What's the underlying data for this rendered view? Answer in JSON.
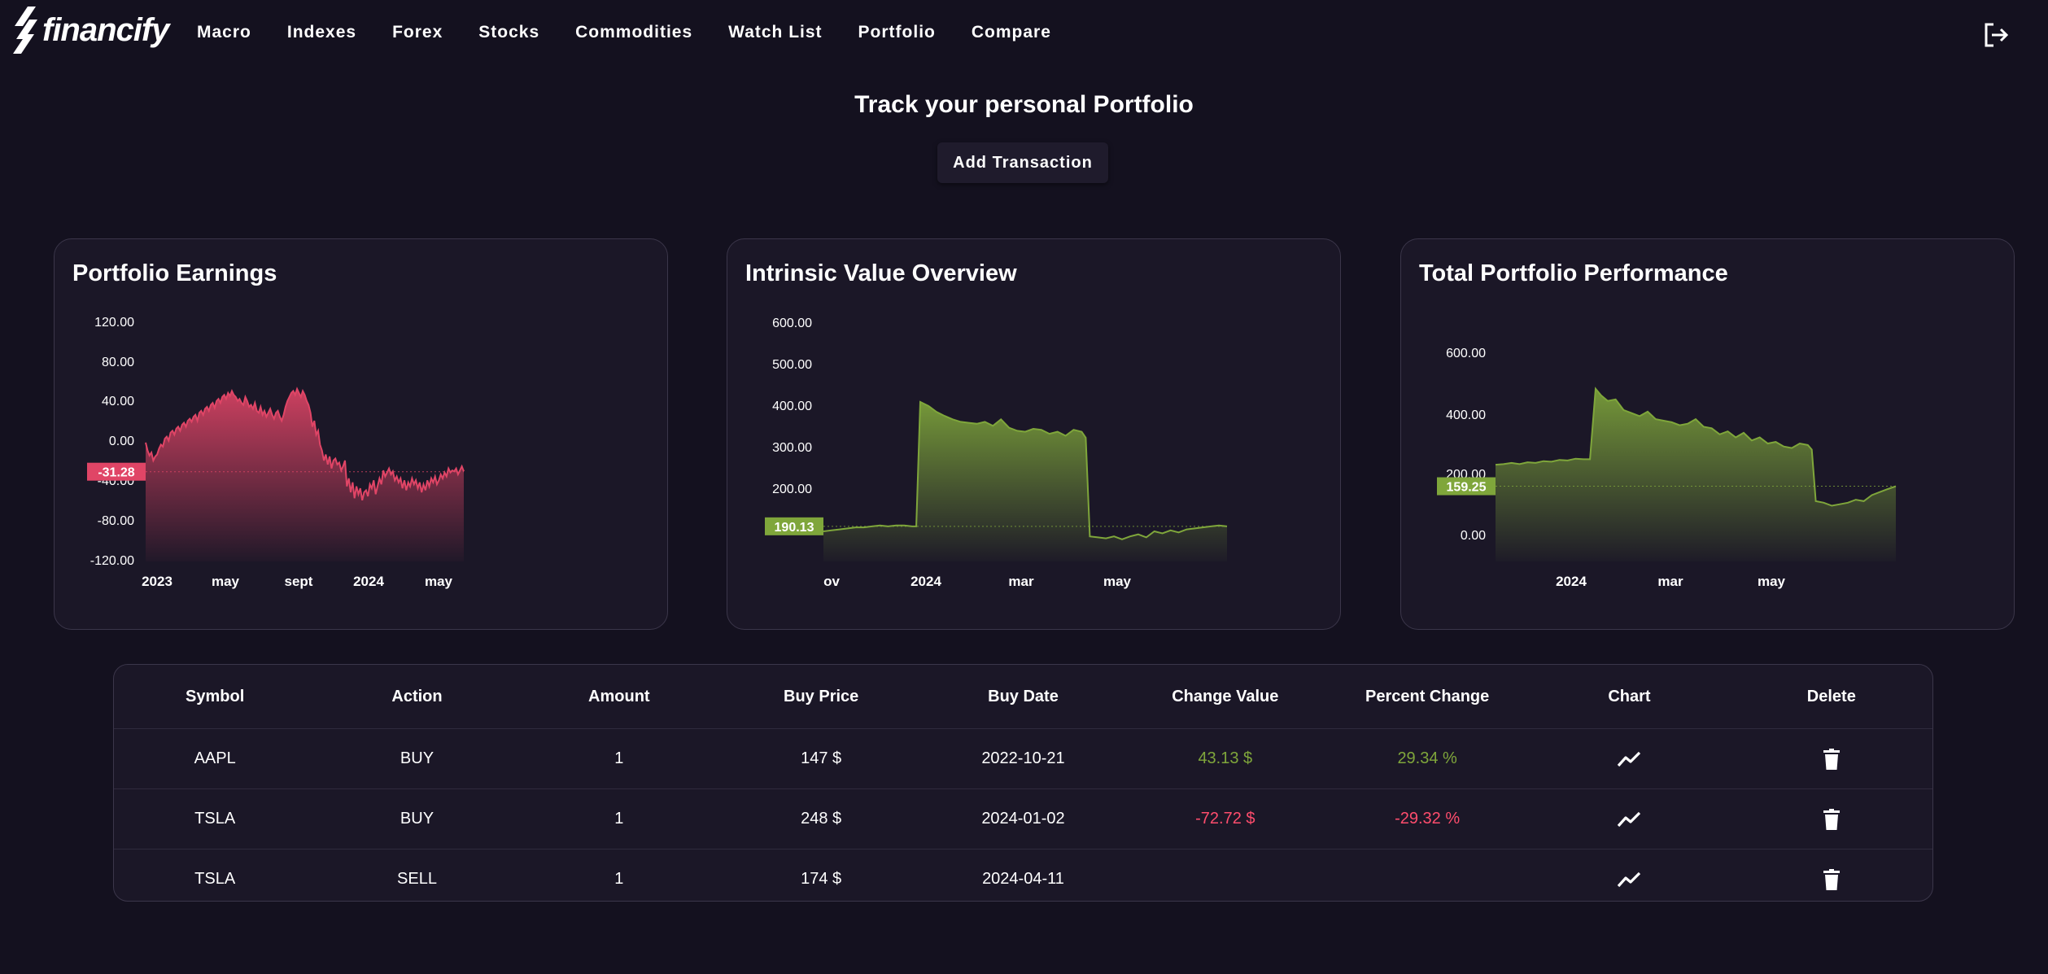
{
  "nav": {
    "logo_text": "financify",
    "links": [
      "Macro",
      "Indexes",
      "Forex",
      "Stocks",
      "Commodities",
      "Watch List",
      "Portfolio",
      "Compare"
    ],
    "logout_icon": "logout-icon"
  },
  "header": {
    "title": "Track your personal Portfolio",
    "add_button": "Add Transaction"
  },
  "colors": {
    "background": "#14111f",
    "negative": "#ff4d6d",
    "positive": "#7fa63b",
    "card": "#1b1727"
  },
  "chart_data": [
    {
      "type": "area",
      "title": "Portfolio Earnings",
      "y_ticks": [
        "120.00",
        "80.00",
        "40.00",
        "0.00",
        "-40.00",
        "-80.00",
        "-120.00"
      ],
      "x_ticks": [
        "2023",
        "may",
        "sept",
        "2024",
        "may"
      ],
      "ylim": [
        -120,
        120
      ],
      "current_value_label": "-31.28",
      "color": "#e04566",
      "x": [
        0,
        3,
        6,
        9,
        12,
        15,
        18,
        21,
        24,
        27,
        30,
        33,
        36,
        39,
        42,
        45,
        48,
        51,
        54,
        57,
        60,
        63,
        66,
        69,
        72,
        75,
        78,
        81,
        84,
        87,
        90,
        93,
        96,
        99,
        102,
        105,
        108,
        111,
        114,
        117,
        120,
        123,
        126,
        129,
        132,
        135,
        138,
        141,
        144,
        147,
        150,
        153,
        156,
        159,
        162,
        165,
        168,
        171,
        174,
        177,
        180,
        183,
        186,
        189,
        192,
        195,
        198,
        201,
        204,
        207,
        210,
        213,
        216,
        219,
        222,
        225,
        228,
        231,
        234,
        237,
        240,
        243,
        246,
        249,
        252,
        255,
        258,
        261,
        264,
        267,
        270,
        273,
        276,
        279,
        282,
        285,
        288,
        291,
        294,
        297,
        300,
        303,
        306,
        309,
        312,
        315,
        318,
        321,
        324,
        327,
        330,
        333,
        336,
        339,
        342,
        345,
        348,
        351,
        354,
        357,
        360,
        363,
        366,
        369,
        372,
        375,
        378,
        381,
        384,
        387,
        390,
        393,
        396,
        399,
        402,
        405,
        408,
        411,
        414,
        417,
        420,
        423,
        426,
        429,
        432,
        435,
        438,
        441,
        444,
        447,
        450,
        453,
        456,
        459,
        462,
        465,
        468,
        471,
        474,
        477,
        480,
        483,
        486,
        489,
        492,
        495,
        498
      ],
      "values": [
        -2,
        -10,
        -15,
        -12,
        -20,
        -16,
        -14,
        -8,
        -4,
        -6,
        2,
        4,
        0,
        8,
        10,
        6,
        12,
        14,
        10,
        16,
        18,
        14,
        20,
        22,
        19,
        24,
        26,
        20,
        28,
        30,
        26,
        32,
        34,
        30,
        36,
        38,
        33,
        40,
        42,
        38,
        44,
        46,
        42,
        48,
        45,
        50,
        46,
        44,
        40,
        42,
        38,
        36,
        44,
        40,
        34,
        36,
        32,
        38,
        30,
        28,
        34,
        26,
        30,
        24,
        28,
        32,
        26,
        22,
        28,
        30,
        24,
        20,
        26,
        34,
        40,
        44,
        48,
        50,
        46,
        52,
        48,
        44,
        50,
        46,
        40,
        36,
        28,
        14,
        20,
        6,
        10,
        -4,
        -10,
        -20,
        -14,
        -24,
        -16,
        -28,
        -20,
        -18,
        -24,
        -22,
        -30,
        -26,
        -20,
        -46,
        -38,
        -52,
        -42,
        -58,
        -46,
        -54,
        -48,
        -60,
        -52,
        -50,
        -56,
        -44,
        -48,
        -40,
        -54,
        -46,
        -38,
        -44,
        -30,
        -36,
        -32,
        -28,
        -34,
        -31,
        -40,
        -36,
        -42,
        -38,
        -48,
        -40,
        -50,
        -42,
        -46,
        -38,
        -44,
        -40,
        -48,
        -42,
        -52,
        -44,
        -50,
        -40,
        -46,
        -38,
        -42,
        -36,
        -44,
        -40,
        -34,
        -38,
        -32,
        -36,
        -28,
        -32,
        -30,
        -31,
        -28,
        -34,
        -30,
        -26,
        -31
      ]
    },
    {
      "type": "area",
      "title": "Intrinsic Value Overview",
      "y_ticks": [
        "600.00",
        "500.00",
        "400.00",
        "300.00",
        "200.00",
        "100.00"
      ],
      "x_ticks": [
        "ov",
        "2024",
        "mar",
        "may"
      ],
      "ylim": [
        0,
        600
      ],
      "current_value_label": "190.13",
      "color": "#7fa63b",
      "x": [
        0,
        10,
        20,
        30,
        40,
        50,
        60,
        70,
        80,
        90,
        100,
        110,
        115,
        120,
        130,
        140,
        150,
        160,
        170,
        180,
        190,
        200,
        210,
        220,
        230,
        240,
        250,
        260,
        270,
        280,
        290,
        300,
        310,
        320,
        325,
        330,
        340,
        350,
        360,
        370,
        380,
        390,
        400,
        410,
        420,
        430,
        440,
        450,
        460,
        470,
        480,
        490,
        500
      ],
      "values": [
        180,
        182,
        184,
        186,
        188,
        188,
        190,
        192,
        190,
        192,
        192,
        190,
        190,
        440,
        432,
        420,
        412,
        405,
        400,
        398,
        396,
        400,
        392,
        405,
        388,
        382,
        380,
        386,
        384,
        376,
        380,
        372,
        384,
        380,
        368,
        170,
        168,
        166,
        170,
        164,
        170,
        174,
        168,
        180,
        176,
        182,
        178,
        184,
        186,
        188,
        190,
        192,
        190
      ]
    },
    {
      "type": "area",
      "title": "Total Portfolio Performance",
      "y_ticks": [
        "600.00",
        "400.00",
        "200.00",
        "0.00"
      ],
      "x_ticks": [
        "2024",
        "mar",
        "may"
      ],
      "ylim": [
        -100,
        700
      ],
      "current_value_label": "159.25",
      "color": "#7fa63b",
      "x": [
        0,
        10,
        20,
        30,
        40,
        50,
        60,
        70,
        80,
        90,
        100,
        110,
        118,
        125,
        132,
        140,
        150,
        160,
        170,
        180,
        190,
        200,
        210,
        220,
        230,
        240,
        250,
        260,
        270,
        280,
        290,
        300,
        310,
        320,
        330,
        340,
        350,
        360,
        370,
        380,
        390,
        395,
        400,
        410,
        420,
        430,
        440,
        450,
        460,
        470,
        480,
        490,
        500
      ],
      "values": [
        230,
        232,
        236,
        232,
        238,
        236,
        242,
        240,
        246,
        244,
        250,
        248,
        248,
        480,
        458,
        440,
        445,
        410,
        400,
        390,
        405,
        380,
        375,
        370,
        360,
        365,
        380,
        355,
        350,
        330,
        340,
        320,
        335,
        310,
        320,
        300,
        305,
        290,
        285,
        300,
        295,
        280,
        110,
        105,
        95,
        100,
        105,
        115,
        110,
        130,
        140,
        150,
        159
      ]
    }
  ],
  "table": {
    "headers": [
      "Symbol",
      "Action",
      "Amount",
      "Buy Price",
      "Buy Date",
      "Change Value",
      "Percent Change",
      "Chart",
      "Delete"
    ],
    "rows": [
      {
        "symbol": "AAPL",
        "action": "BUY",
        "amount": "1",
        "buy_price": "147 $",
        "buy_date": "2022-10-21",
        "change_value": "43.13 $",
        "percent_change": "29.34 %",
        "trend": "positive",
        "chart_icon": "trend-chart-icon",
        "delete_icon": "trash-icon"
      },
      {
        "symbol": "TSLA",
        "action": "BUY",
        "amount": "1",
        "buy_price": "248 $",
        "buy_date": "2024-01-02",
        "change_value": "-72.72 $",
        "percent_change": "-29.32 %",
        "trend": "negative",
        "chart_icon": "trend-chart-icon",
        "delete_icon": "trash-icon"
      },
      {
        "symbol": "TSLA",
        "action": "SELL",
        "amount": "1",
        "buy_price": "174 $",
        "buy_date": "2024-04-11",
        "change_value": "",
        "percent_change": "",
        "trend": "none",
        "chart_icon": "trend-chart-icon",
        "delete_icon": "trash-icon"
      }
    ]
  }
}
